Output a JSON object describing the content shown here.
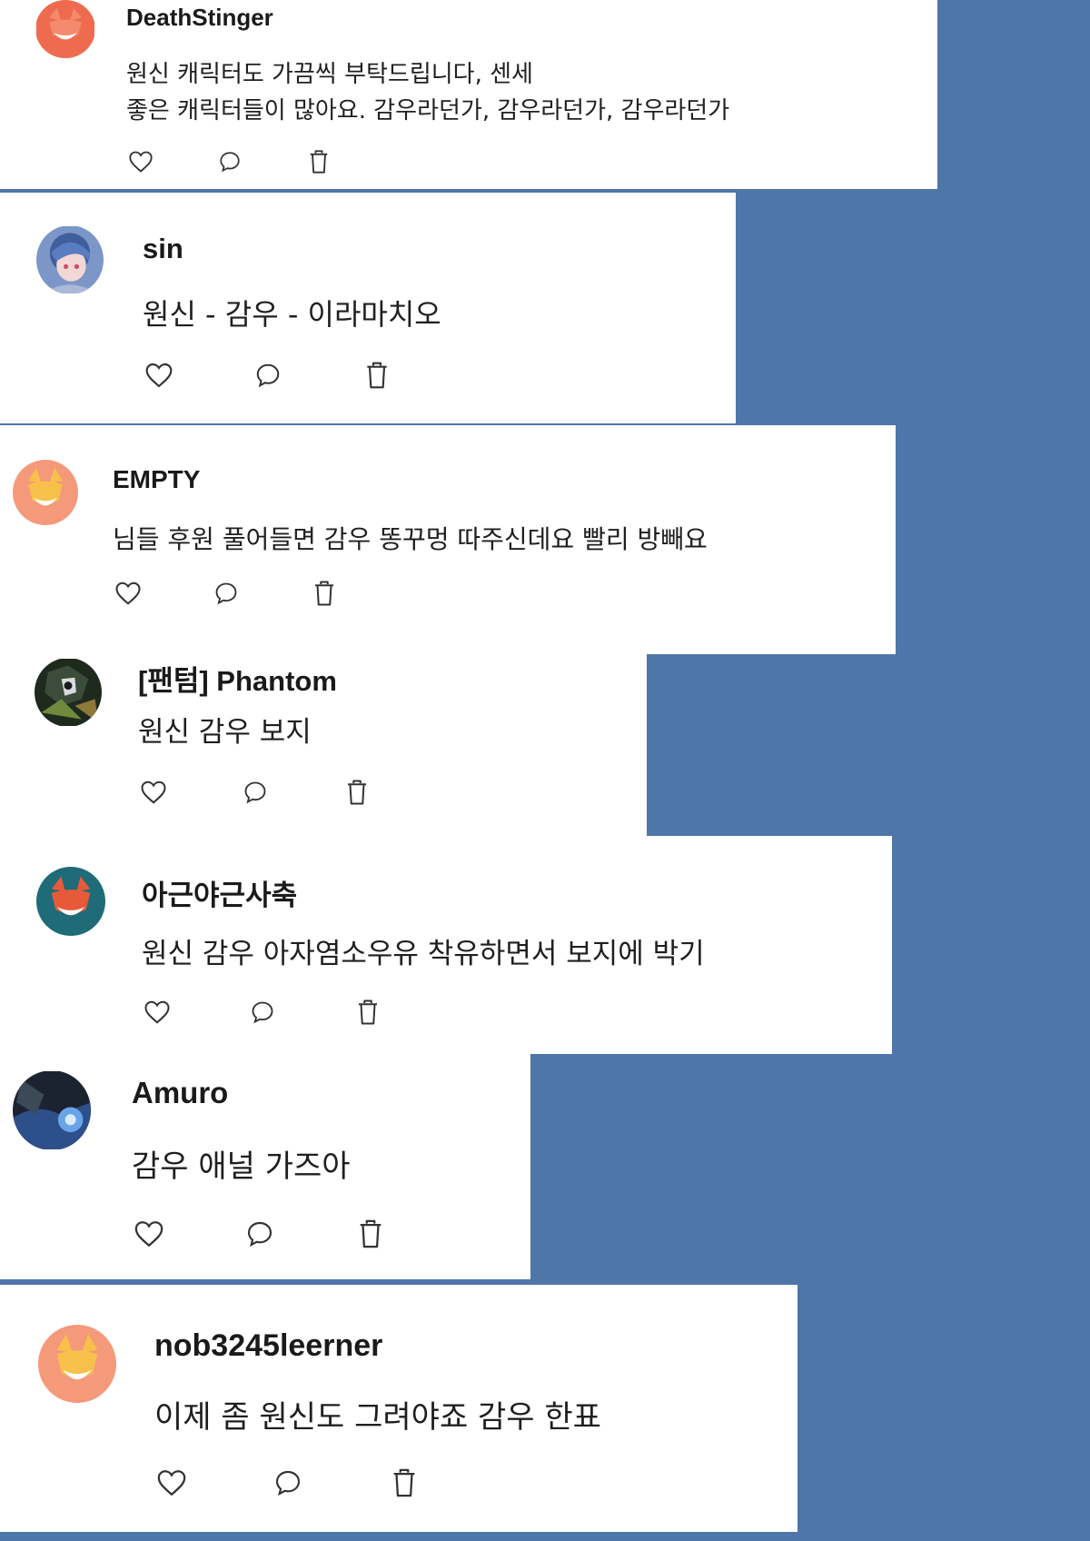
{
  "colors": {
    "background": "#4f76a9",
    "card": "#ffffff",
    "icon_stroke": "#333333"
  },
  "comments": [
    {
      "username": "DeathStinger",
      "avatar": "orange-fox-avatar",
      "lines": [
        "원신 캐릭터도 가끔씩 부탁드립니다, 센세",
        "좋은 캐릭터들이 많아요. 감우라던가, 감우라던가, 감우라던가"
      ]
    },
    {
      "username": "sin",
      "avatar": "anime-character-avatar",
      "lines": [
        "원신 - 감우 - 이라마치오"
      ]
    },
    {
      "username": "EMPTY",
      "avatar": "peach-fox-avatar",
      "lines": [
        "님들 후원 풀어들면 감우 똥꾸멍 따주신데요 빨리 방빼요"
      ]
    },
    {
      "username": "[팬텀] Phantom",
      "avatar": "dark-art-avatar",
      "lines": [
        "원신 감우 보지"
      ]
    },
    {
      "username": "아근야근사축",
      "avatar": "teal-fox-avatar",
      "lines": [
        "원신 감우 아자염소우유 착유하면서 보지에 박기"
      ]
    },
    {
      "username": "Amuro",
      "avatar": "dark-blue-art-avatar",
      "lines": [
        "감우 애널 가즈아"
      ]
    },
    {
      "username": "nob3245leerner",
      "avatar": "peach-fox-avatar",
      "lines": [
        "이제 좀 원신도 그려야죠 감우 한표"
      ]
    }
  ],
  "actions": {
    "like_icon": "heart-icon",
    "reply_icon": "speech-bubble-icon",
    "delete_icon": "trash-icon"
  }
}
